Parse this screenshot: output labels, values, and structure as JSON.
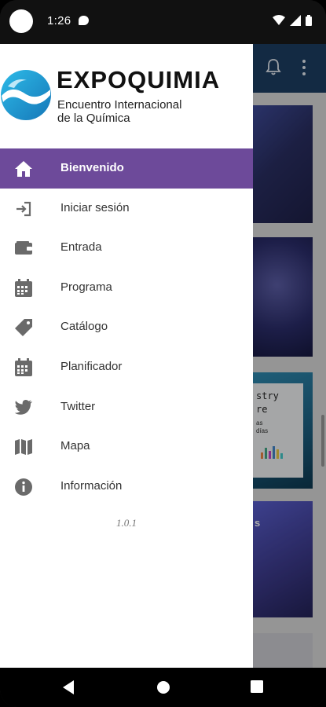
{
  "status_bar": {
    "time": "1:26"
  },
  "brand": {
    "name": "EXPOQUIMIA",
    "tagline_line1": "Encuentro Internacional",
    "tagline_line2": "de la Química",
    "logo_color": "#1ba1d6"
  },
  "menu": {
    "items": [
      {
        "label": "Bienvenido",
        "icon": "home-icon",
        "active": true
      },
      {
        "label": "Iniciar sesión",
        "icon": "login-icon",
        "active": false
      },
      {
        "label": "Entrada",
        "icon": "wallet-icon",
        "active": false
      },
      {
        "label": "Programa",
        "icon": "calendar-icon",
        "active": false
      },
      {
        "label": "Catálogo",
        "icon": "tag-icon",
        "active": false
      },
      {
        "label": "Planificador",
        "icon": "calendar-icon",
        "active": false
      },
      {
        "label": "Twitter",
        "icon": "twitter-icon",
        "active": false
      },
      {
        "label": "Mapa",
        "icon": "map-icon",
        "active": false
      },
      {
        "label": "Información",
        "icon": "info-icon",
        "active": false
      }
    ],
    "active_color": "#6d4a9a"
  },
  "version": "1.0.1",
  "background_app": {
    "card3_text": "stry\nre",
    "card3_small": "as\ndías",
    "card4_text": "s"
  }
}
